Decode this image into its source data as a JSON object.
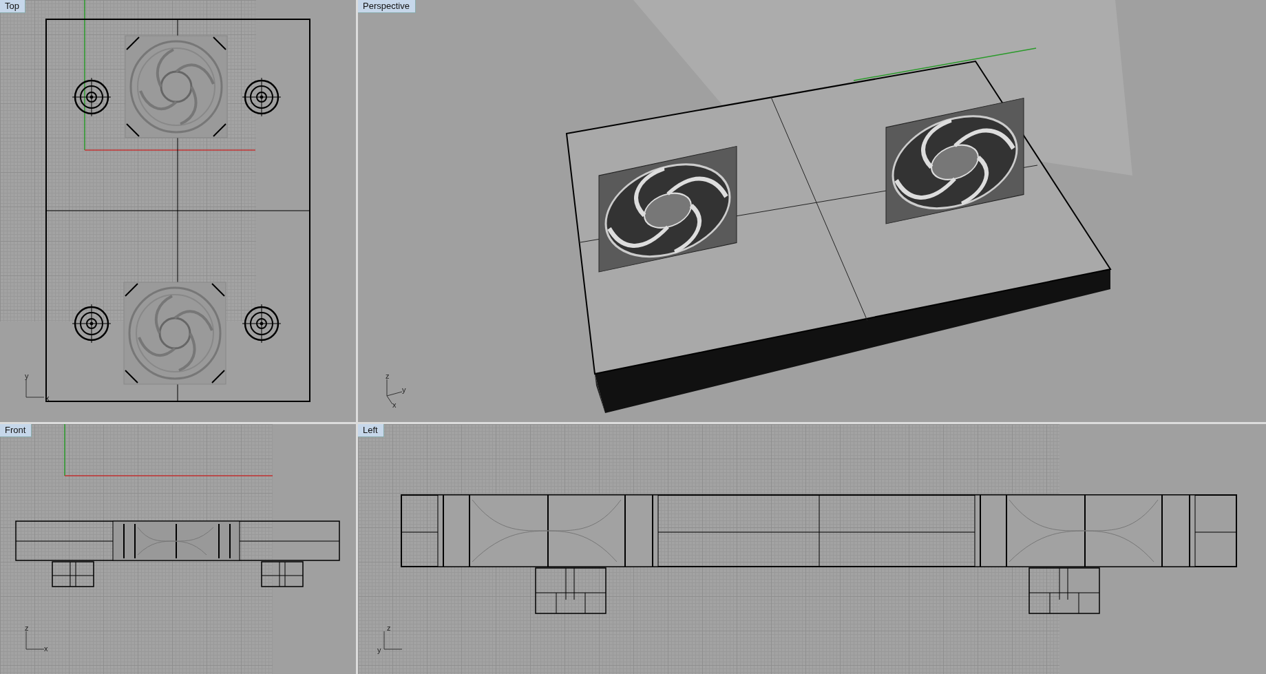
{
  "viewports": [
    {
      "title": "Top",
      "kind": "top",
      "axes": [
        "y",
        "x"
      ]
    },
    {
      "title": "Perspective",
      "kind": "perspective",
      "axes": [
        "z",
        "y",
        "x"
      ]
    },
    {
      "title": "Front",
      "kind": "front",
      "axes": [
        "z",
        "x"
      ]
    },
    {
      "title": "Left",
      "kind": "left",
      "axes": [
        "z",
        "y"
      ]
    }
  ]
}
